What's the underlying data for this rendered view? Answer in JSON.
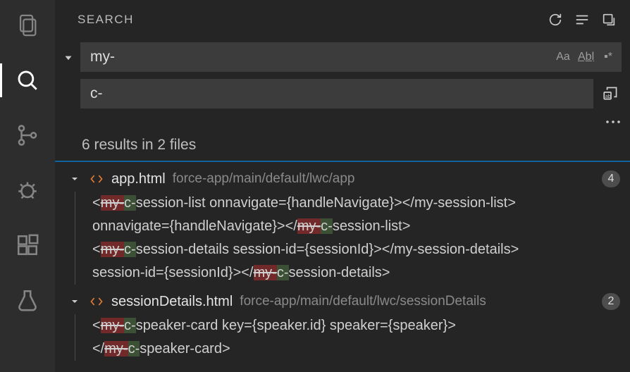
{
  "activity": {
    "items": [
      "explorer",
      "search",
      "scm",
      "debug",
      "extensions",
      "testing"
    ],
    "active": "search"
  },
  "header": {
    "title": "SEARCH"
  },
  "search": {
    "find_value": "my-",
    "replace_value": "c-"
  },
  "summary": "6 results in 2 files",
  "files": [
    {
      "name": "app.html",
      "path": "force-app/main/default/lwc/app",
      "count": "4",
      "matches": [
        {
          "pre": "<",
          "del": "my-",
          "ins": "c-",
          "post": "session-list onnavigate={handleNavigate}></my-session-list>"
        },
        {
          "pre": "onnavigate={handleNavigate}></",
          "del": "my-",
          "ins": "c-",
          "post": "session-list>"
        },
        {
          "pre": "<",
          "del": "my-",
          "ins": "c-",
          "post": "session-details session-id={sessionId}></my-session-details>"
        },
        {
          "pre": "session-id={sessionId}></",
          "del": "my-",
          "ins": "c-",
          "post": "session-details>"
        }
      ]
    },
    {
      "name": "sessionDetails.html",
      "path": "force-app/main/default/lwc/sessionDetails",
      "count": "2",
      "matches": [
        {
          "pre": "<",
          "del": "my-",
          "ins": "c-",
          "post": "speaker-card key={speaker.id} speaker={speaker}>"
        },
        {
          "pre": "</",
          "del": "my-",
          "ins": "c-",
          "post": "speaker-card>"
        }
      ]
    }
  ]
}
